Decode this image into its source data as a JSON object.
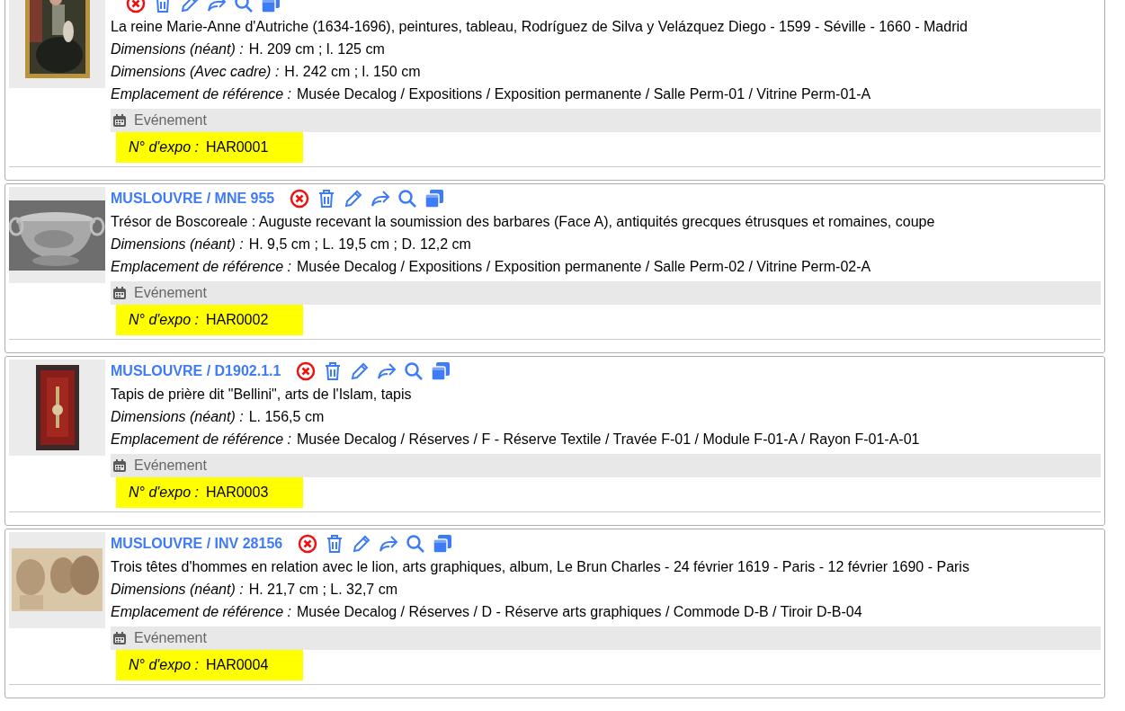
{
  "records": [
    {
      "description": "La reine Marie-Anne d'Autriche (1634-1696), peintures, tableau, Rodríguez de Silva y Velázquez Diego - 1599 - Séville - 1660 - Madrid",
      "fields": [
        {
          "label": "Dimensions (néant) :",
          "value": "H. 209 cm ; l. 125 cm"
        },
        {
          "label": "Dimensions (Avec cadre) :",
          "value": "H. 242 cm ; l. 150 cm"
        },
        {
          "label": "Emplacement de référence :",
          "value": "Musée Decalog / Expositions / Exposition permanente / Salle Perm-01 / Vitrine Perm-01-A"
        }
      ],
      "event_header": "Evénement",
      "expo_label": "N° d'expo :",
      "expo_value": "HAR0001"
    },
    {
      "title": "MUSLOUVRE / MNE 955",
      "description": "Trésor de Boscoreale : Auguste recevant la soumission des barbares (Face A), antiquités grecques étrusques et romaines, coupe",
      "fields": [
        {
          "label": "Dimensions (néant) :",
          "value": "H. 9,5 cm ; L. 19,5 cm ; D. 12,2 cm"
        },
        {
          "label": "Emplacement de référence :",
          "value": "Musée Decalog / Expositions / Exposition permanente / Salle Perm-02 / Vitrine Perm-02-A"
        }
      ],
      "event_header": "Evénement",
      "expo_label": "N° d'expo :",
      "expo_value": "HAR0002"
    },
    {
      "title": "MUSLOUVRE / D1902.1.1",
      "description": "Tapis de prière dit \"Bellini\", arts de l'Islam, tapis",
      "fields": [
        {
          "label": "Dimensions (néant) :",
          "value": "L. 156,5 cm"
        },
        {
          "label": "Emplacement de référence :",
          "value": "Musée Decalog / Réserves / F - Réserve Textile / Travée F-01 / Module F-01-A / Rayon F-01-A-01"
        }
      ],
      "event_header": "Evénement",
      "expo_label": "N° d'expo :",
      "expo_value": "HAR0003"
    },
    {
      "title": "MUSLOUVRE / INV 28156",
      "description": "Trois têtes d'hommes en relation avec le lion, arts graphiques, album, Le Brun Charles - 24 février 1619 - Paris - 12 février 1690 - Paris",
      "fields": [
        {
          "label": "Dimensions (néant) :",
          "value": "H. 21,7 cm ; L. 32,7 cm"
        },
        {
          "label": "Emplacement de référence :",
          "value": "Musée Decalog / Réserves / D - Réserve arts graphiques / Commode D-B / Tiroir D-B-04"
        }
      ],
      "event_header": "Evénement",
      "expo_label": "N° d'expo :",
      "expo_value": "HAR0004"
    }
  ]
}
